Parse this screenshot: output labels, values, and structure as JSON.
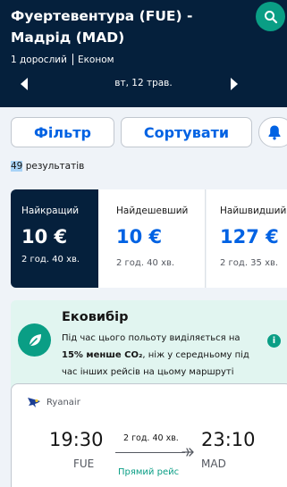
{
  "header": {
    "title": "Фуертевентура (FUE) - Мадрід (MAD)",
    "passengers": "1 дорослий",
    "cabin": "Економ",
    "date": "вт, 12 трав."
  },
  "controls": {
    "filter_label": "Фільтр",
    "sort_label": "Сортувати"
  },
  "results": {
    "count": "49",
    "suffix": " результатів"
  },
  "tabs": [
    {
      "label": "Найкращий",
      "price": "10 €",
      "duration": "2 год. 40 хв."
    },
    {
      "label": "Найдешевший",
      "price": "10 €",
      "duration": "2 год. 40 хв."
    },
    {
      "label": "Найшвидший",
      "price": "127 €",
      "duration": "2 год. 35 хв."
    }
  ],
  "eco": {
    "title": "Ековибір",
    "text_before": "Під час цього польоту виділяється на ",
    "text_bold": "15% менше CO₂",
    "text_after": ", ніж у середньому під час інших рейсів на цьому маршруті",
    "info": "i"
  },
  "flight": {
    "airline": "Ryanair",
    "departure_time": "19:30",
    "departure_code": "FUE",
    "arrival_time": "23:10",
    "arrival_code": "MAD",
    "duration": "2 год. 40 хв.",
    "stops": "Прямий рейс"
  },
  "colors": {
    "header_bg": "#05203c",
    "accent_blue": "#0062e3",
    "eco_green": "#0a9e85",
    "eco_bg": "#e1f5f0"
  }
}
